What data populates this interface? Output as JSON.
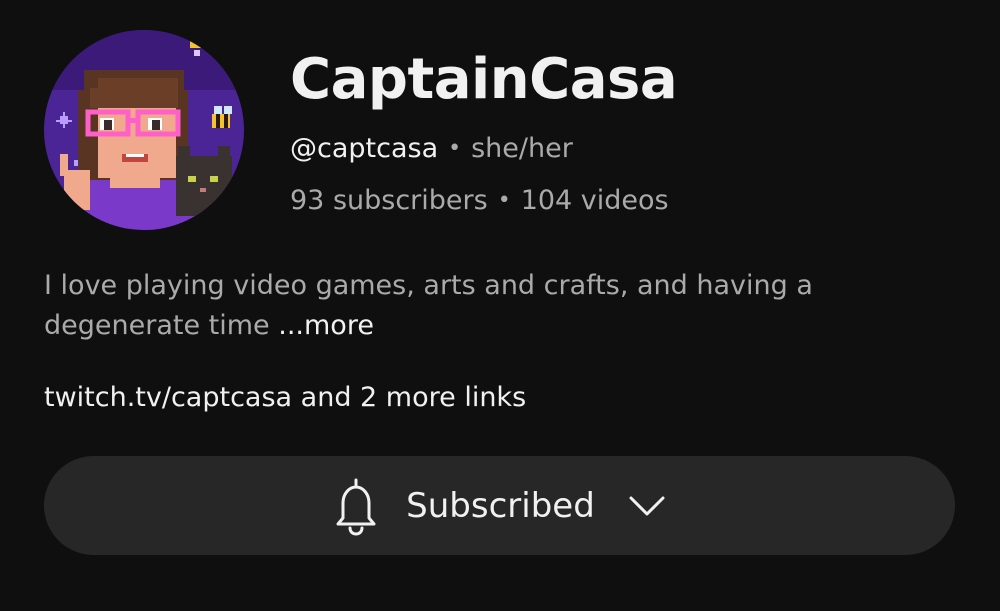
{
  "channel": {
    "name": "CaptainCasa",
    "handle": "@captcasa",
    "pronouns": "she/her",
    "subscribers": "93 subscribers",
    "videos": "104 videos",
    "separator": "•"
  },
  "description": {
    "text": "I love playing video games, arts and crafts, and having a degenerate time",
    "more_label": "...more"
  },
  "links": {
    "text": "twitch.tv/captcasa and 2 more links"
  },
  "subscribe_button": {
    "label": "Subscribed",
    "icon": "bell-icon",
    "dropdown_icon": "chevron-down-icon"
  },
  "avatar": {
    "icon": "pixel-art-avatar"
  },
  "colors": {
    "background": "#0f0f0f",
    "primary_text": "#f1f1f1",
    "secondary_text": "#aaaaaa",
    "button_bg": "#272727",
    "avatar_purple": "#5a2bb0"
  }
}
